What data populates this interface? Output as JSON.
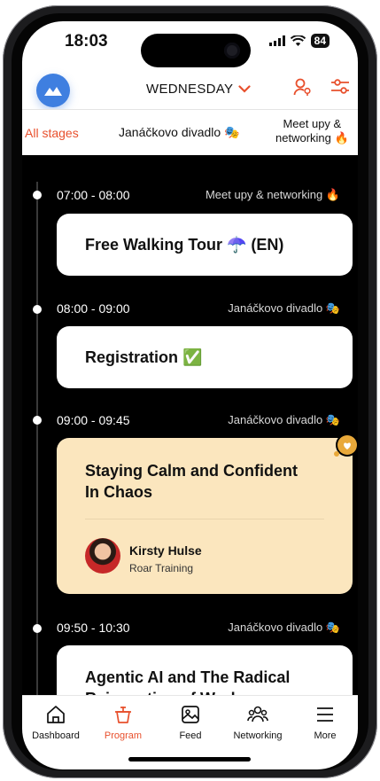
{
  "status_bar": {
    "time": "18:03",
    "battery": "84"
  },
  "header": {
    "day": "WEDNESDAY"
  },
  "tabs": [
    {
      "label": "All stages",
      "active": true
    },
    {
      "label": "Janáčkovo divadlo 🎭"
    },
    {
      "label_line1": "Meet upy &",
      "label_line2": "networking 🔥"
    }
  ],
  "sessions": [
    {
      "time": "07:00 - 08:00",
      "stage": "Meet upy & networking 🔥",
      "title": "Free Walking Tour ☂️ (EN)"
    },
    {
      "time": "08:00 - 09:00",
      "stage": "Janáčkovo divadlo 🎭",
      "title": "Registration ✅"
    },
    {
      "time": "09:00 - 09:45",
      "stage": "Janáčkovo divadlo 🎭",
      "title_line1": "Staying Calm and Confident",
      "title_line2": "In Chaos",
      "speaker": {
        "name": "Kirsty Hulse",
        "org": "Roar Training"
      },
      "favorited": true
    },
    {
      "time": "09:50 - 10:30",
      "stage": "Janáčkovo divadlo 🎭",
      "title_line1": "Agentic AI and The Radical",
      "title_line2": "Reinvention of Work"
    }
  ],
  "bottom_nav": [
    {
      "label": "Dashboard",
      "icon": "home-icon"
    },
    {
      "label": "Program",
      "icon": "podium-icon",
      "active": true
    },
    {
      "label": "Feed",
      "icon": "image-icon"
    },
    {
      "label": "Networking",
      "icon": "people-icon"
    },
    {
      "label": "More",
      "icon": "menu-icon"
    }
  ],
  "colors": {
    "accent": "#e8502d",
    "logo": "#3f7fe0",
    "featured_card": "#fbe6be"
  }
}
